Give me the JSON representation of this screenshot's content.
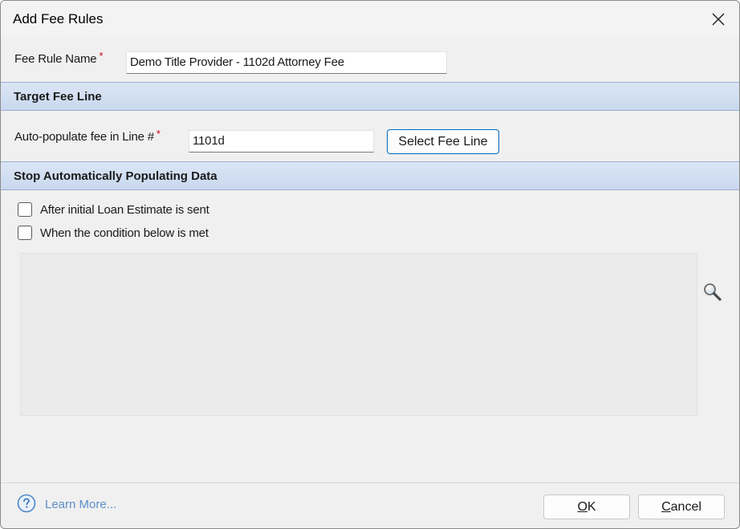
{
  "window": {
    "title": "Add Fee Rules"
  },
  "fee_rule_name": {
    "label": "Fee Rule Name",
    "required_marker": "*",
    "value": "Demo Title Provider - 1102d Attorney Fee"
  },
  "target_section": {
    "header": "Target Fee Line",
    "line_label": "Auto-populate fee in Line #",
    "required_marker": "*",
    "line_value": "1101d",
    "select_button": "Select Fee Line"
  },
  "stop_section": {
    "header": "Stop Automatically Populating Data",
    "options": [
      {
        "label": "After initial Loan Estimate is sent",
        "checked": false
      },
      {
        "label": "When the condition below is met",
        "checked": false
      }
    ],
    "search_icon": "magnifier-icon"
  },
  "footer": {
    "help_icon": "question-circle-icon",
    "learn_more": "Learn More...",
    "ok_first": "O",
    "ok_rest": "K",
    "cancel_first": "C",
    "cancel_rest": "ancel"
  },
  "colors": {
    "section_header_bg": "#c9d8ee",
    "link": "#5b8fc9",
    "required": "#d0021b",
    "accent_border": "#0067c0"
  }
}
